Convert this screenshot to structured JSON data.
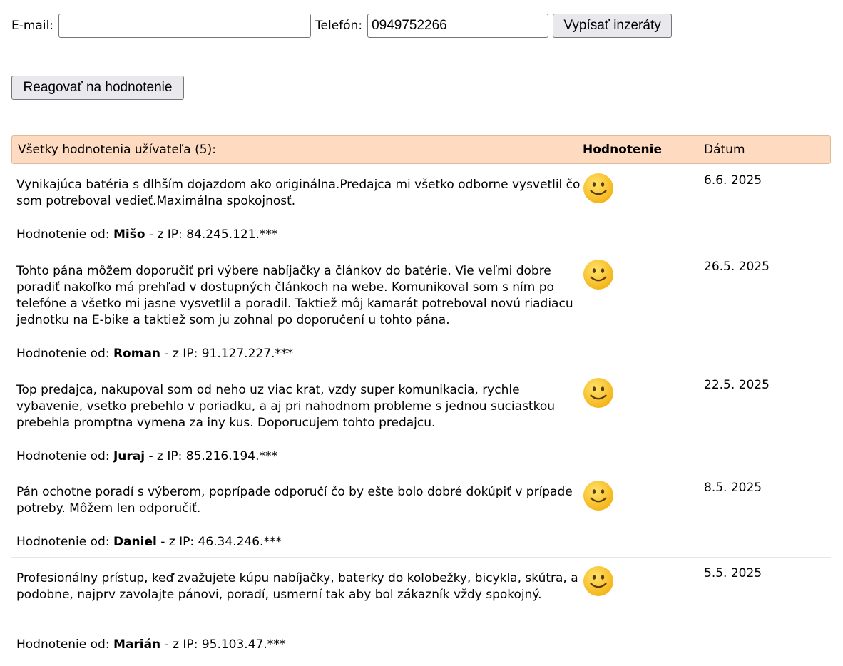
{
  "search": {
    "email_label": "E-mail:",
    "email_value": "",
    "phone_label": "Telefón:",
    "phone_value": "0949752266",
    "list_button": "Vypísať inzeráty"
  },
  "react_button": "Reagovať na hodnotenie",
  "table": {
    "title": "Všetky hodnotenia užívateľa (5):",
    "rating_header": "Hodnotenie",
    "date_header": "Dátum",
    "author_prefix": "Hodnotenie od:",
    "ip_prefix": "- z IP:",
    "rows": [
      {
        "comment": "Vynikajúca batéria s dlhším dojazdom ako originálna.Predajca mi všetko odborne vysvetlil čo som potreboval vedieť.Maximálna spokojnosť.",
        "author": "Mišo",
        "ip": "84.245.121.***",
        "rating_icon": "smiley-positive",
        "date": "6.6. 2025"
      },
      {
        "comment": "Tohto pána môžem doporučiť pri výbere nabíjačky a článkov do batérie. Vie veľmi dobre poradiť nakoľko má prehľad v dostupných článkoch na webe. Komunikoval som s ním po telefóne a všetko mi jasne vysvetlil a poradil. Taktiež môj kamarát potreboval novú riadiacu jednotku na E-bike a taktiež som ju zohnal po doporučení u tohto pána.",
        "author": "Roman",
        "ip": "91.127.227.***",
        "rating_icon": "smiley-positive",
        "date": "26.5. 2025"
      },
      {
        "comment": "Top predajca, nakupoval som od neho uz viac krat, vzdy super komunikacia, rychle vybavenie, vsetko prebehlo v poriadku, a aj pri nahodnom probleme s jednou suciastkou prebehla promptna vymena za iny kus. Doporucujem tohto predajcu.",
        "author": "Juraj",
        "ip": "85.216.194.***",
        "rating_icon": "smiley-positive",
        "date": "22.5. 2025"
      },
      {
        "comment": "Pán ochotne poradí s výberom, poprípade odporučí čo by ešte bolo dobré dokúpiť v prípade potreby. Môžem len odporučiť.",
        "author": "Daniel",
        "ip": "46.34.246.***",
        "rating_icon": "smiley-positive",
        "date": "8.5. 2025"
      },
      {
        "comment": "Profesionálny prístup, keď zvažujete kúpu nabíjačky, baterky do kolobežky, bicykla, skútra, a podobne, najprv zavolajte pánovi, poradí, usmerní tak aby bol zákazník vždy spokojný.",
        "author": "Marián",
        "ip": "95.103.47.***",
        "rating_icon": "smiley-positive",
        "date": "5.5. 2025"
      }
    ]
  }
}
